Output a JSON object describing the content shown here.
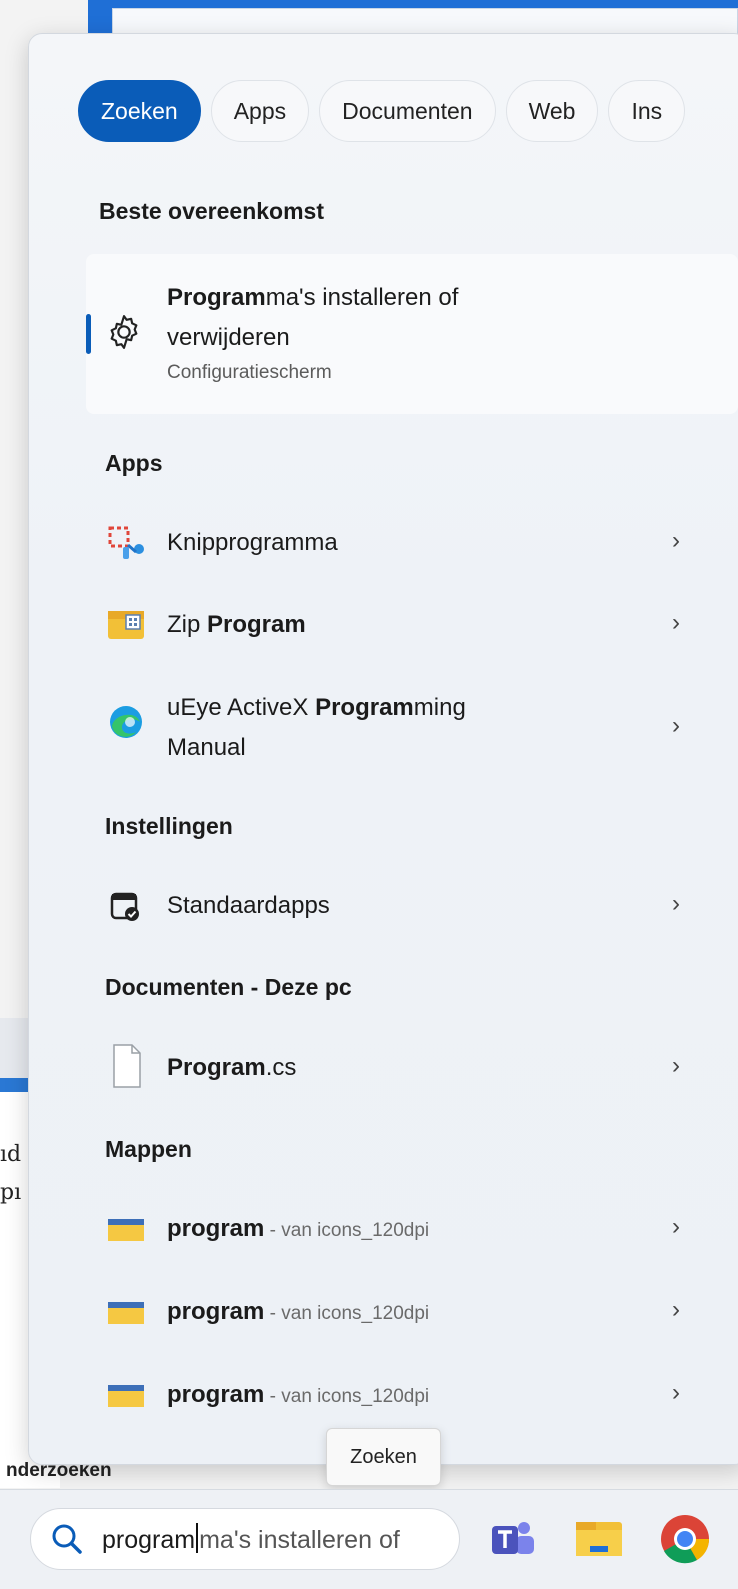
{
  "filters": [
    "Zoeken",
    "Apps",
    "Documenten",
    "Web",
    "Ins"
  ],
  "sections": {
    "best": "Beste overeenkomst",
    "apps": "Apps",
    "settings": "Instellingen",
    "docs": "Documenten - Deze pc",
    "folders": "Mappen"
  },
  "best_match": {
    "title_bold": "Program",
    "title_line1_rest": "ma's installeren of",
    "title_line2": "verwijderen",
    "subtitle": "Configuratiescherm",
    "icon": "gear-icon"
  },
  "apps": [
    {
      "pre": "Knipprogramma",
      "bold": "",
      "post": "",
      "icon": "snipping-tool-icon"
    },
    {
      "pre": "Zip ",
      "bold": "Program",
      "post": "",
      "icon": "zip-program-icon"
    },
    {
      "pre": "uEye ActiveX ",
      "bold": "Program",
      "post": "ming",
      "line2": "Manual",
      "icon": "edge-icon"
    }
  ],
  "settings": [
    {
      "label": "Standaardapps",
      "icon": "default-apps-icon"
    }
  ],
  "documents": [
    {
      "bold": "Program",
      "post": ".cs",
      "icon": "file-icon"
    }
  ],
  "folders": [
    {
      "bold": "program",
      "sep": " - ",
      "location": "van icons_120dpi",
      "icon": "folder-icon"
    },
    {
      "bold": "program",
      "sep": " - ",
      "location": "van icons_120dpi",
      "icon": "folder-icon"
    },
    {
      "bold": "program",
      "sep": " - ",
      "location": "van icons_120dpi",
      "icon": "folder-icon"
    }
  ],
  "chevron": "›",
  "tooltip": "Zoeken",
  "taskbar": {
    "search_typed": "program",
    "search_suggest": "ma's installeren of",
    "apps": [
      "teams-icon",
      "file-explorer-icon",
      "chrome-icon"
    ]
  },
  "background": {
    "left_text_1": "ıd",
    "left_text_2": "pı",
    "bottom_text": "nderzoeken"
  },
  "colors": {
    "accent": "#0a5cb8"
  }
}
